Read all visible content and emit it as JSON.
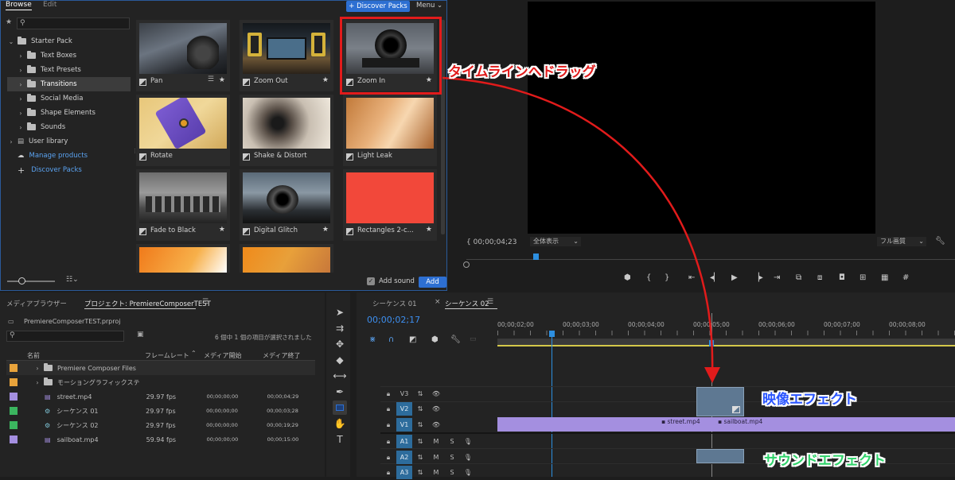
{
  "composer": {
    "tabs": [
      "Browse",
      "Edit"
    ],
    "discover_button": "+ Discover Packs",
    "menu_label": "Menu",
    "tree": [
      {
        "label": "Starter Pack",
        "expanded": true
      },
      {
        "label": "Text Boxes"
      },
      {
        "label": "Text Presets"
      },
      {
        "label": "Transitions",
        "selected": true
      },
      {
        "label": "Social Media"
      },
      {
        "label": "Shape Elements"
      },
      {
        "label": "Sounds"
      },
      {
        "label": "User library"
      },
      {
        "label": "Manage products"
      },
      {
        "label": "Discover Packs"
      }
    ],
    "tiles": [
      "Pan",
      "Zoom Out",
      "Zoom In",
      "Rotate",
      "Shake & Distort",
      "Light Leak",
      "Fade to Black",
      "Digital Glitch",
      "Rectangles 2-c..."
    ],
    "add_sound_label": "Add sound",
    "add_button": "Add"
  },
  "annotations": {
    "drag_to_timeline": "タイムラインへドラッグ",
    "video_effects": "映像エフェクト",
    "sound_effects": "サウンドエフェクト"
  },
  "monitor": {
    "timecode": "00;00;04;23",
    "fit_label": "全体表示",
    "quality_label": "フル画質"
  },
  "project": {
    "tabs": [
      "メディアブラウザー",
      "プロジェクト: PremiereComposerTEST"
    ],
    "file": "PremiereComposerTEST.prproj",
    "selection_status": "6 個中 1 個の項目が選択されました",
    "columns": [
      "名前",
      "フレームレート",
      "メディア開始",
      "メディア終了"
    ],
    "rows": [
      {
        "name": "Premiere Composer Files",
        "color": "#e8a33b",
        "fps": "",
        "start": "",
        "end": "",
        "kind": "folder"
      },
      {
        "name": "モーショングラフィックステ",
        "color": "#e8a33b",
        "fps": "",
        "start": "",
        "end": "",
        "kind": "folder"
      },
      {
        "name": "street.mp4",
        "color": "#a48fe0",
        "fps": "29.97 fps",
        "start": "00;00;00;00",
        "end": "00;00;04;29",
        "kind": "clip"
      },
      {
        "name": "シーケンス 01",
        "color": "#3bb55f",
        "fps": "29.97 fps",
        "start": "00;00;00;00",
        "end": "00;00;03;28",
        "kind": "sequence"
      },
      {
        "name": "シーケンス 02",
        "color": "#3bb55f",
        "fps": "29.97 fps",
        "start": "00;00;00;00",
        "end": "00;00;19;29",
        "kind": "sequence"
      },
      {
        "name": "sailboat.mp4",
        "color": "#a48fe0",
        "fps": "59.94 fps",
        "start": "00;00;00;00",
        "end": "00;00;15:00",
        "kind": "clip"
      }
    ]
  },
  "timeline": {
    "tabs": [
      "シーケンス 01",
      "シーケンス 02"
    ],
    "timecode": "00;00;02;17",
    "ruler": [
      "00;00;02;00",
      "00;00;03;00",
      "00;00;04;00",
      "00;00;05;00",
      "00;00;06;00",
      "00;00;07;00",
      "00;00;08;00"
    ],
    "video_tracks": [
      "V3",
      "V2",
      "V1"
    ],
    "audio_tracks": [
      "A1",
      "A2",
      "A3"
    ],
    "clips": [
      "street.mp4",
      "sailboat.mp4"
    ],
    "m_label": "M",
    "s_label": "S"
  },
  "colors": {
    "accent": "#2d6fd2",
    "annotation_red": "#e11b1b",
    "clip_purple": "#a48fe0",
    "text_blue": "#2a55ff",
    "text_green": "#2fd36a"
  }
}
